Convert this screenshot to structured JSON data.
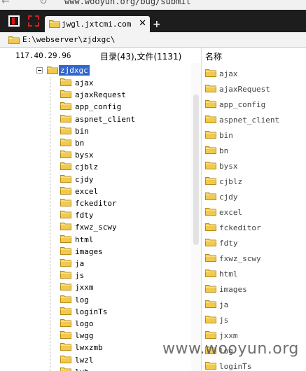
{
  "browser": {
    "url": "www.wooyun.org/bug/submit",
    "tab_title": "jwgl.jxtcmi.com",
    "close_glyph": "✕",
    "new_tab_glyph": "+"
  },
  "icons": {
    "folder": "folder-icon",
    "folder_color": "#f2c94c"
  },
  "path": "E:\\webserver\\zjdxgc\\",
  "left_panel": {
    "ip": "117.40.29.96",
    "summary": "目录(43),文件(1131)",
    "root": "zjdxgc",
    "items": [
      "ajax",
      "ajaxRequest",
      "app_config",
      "aspnet_client",
      "bin",
      "bn",
      "bysx",
      "cjblz",
      "cjdy",
      "excel",
      "fckeditor",
      "fdty",
      "fxwz_scwy",
      "html",
      "images",
      "ja",
      "js",
      "jxxm",
      "log",
      "loginTs",
      "logo",
      "lwgg",
      "lwxzmb",
      "lwzl",
      "lyb"
    ]
  },
  "right_panel": {
    "header": "名称",
    "items": [
      "ajax",
      "ajaxRequest",
      "app_config",
      "aspnet_client",
      "bin",
      "bn",
      "bysx",
      "cjblz",
      "cjdy",
      "excel",
      "fckeditor",
      "fdty",
      "fxwz_scwy",
      "html",
      "images",
      "ja",
      "js",
      "jxxm",
      "log",
      "loginTs"
    ]
  },
  "watermark": "www.wooyun.org"
}
